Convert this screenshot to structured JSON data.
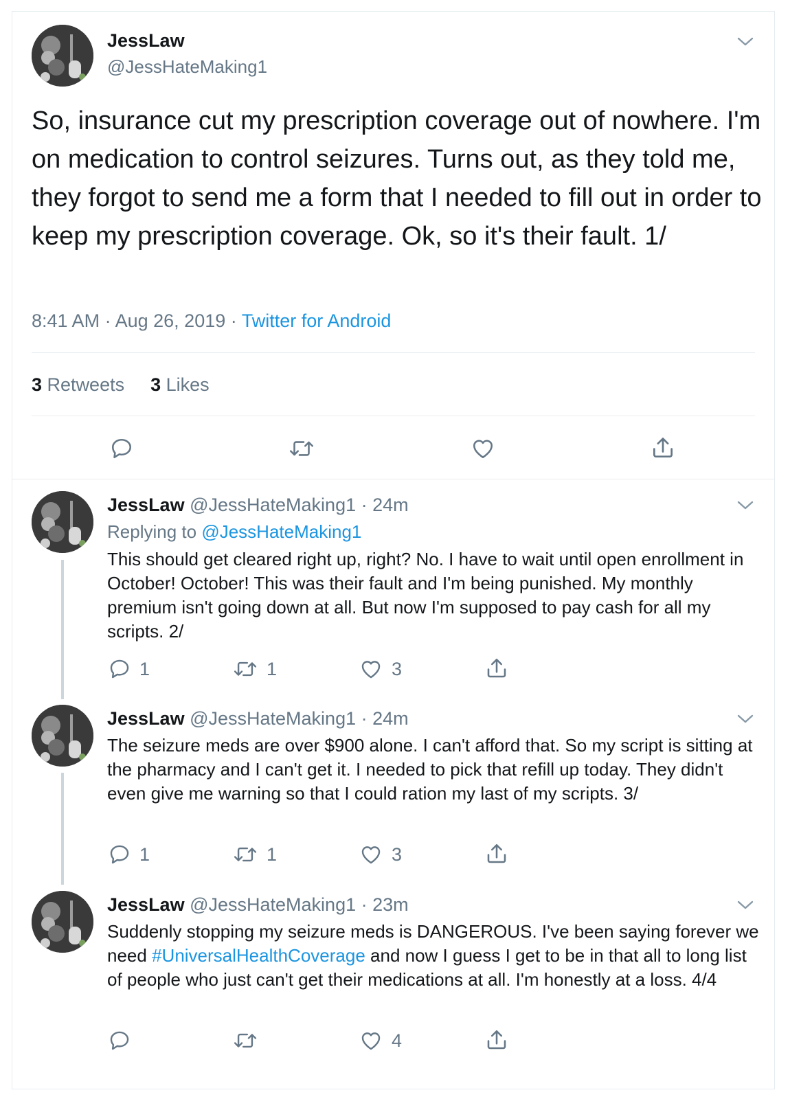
{
  "main_tweet": {
    "display_name": "JessLaw",
    "handle": "@JessHateMaking1",
    "text": "So, insurance cut my prescription coverage out of nowhere. I'm on medication to control seizures. Turns out, as they told me, they forgot to send me a form that I needed to fill out in order to keep my prescription coverage. Ok, so it's their fault. 1/",
    "time": "8:41 AM",
    "date": "Aug 26, 2019",
    "source": "Twitter for Android",
    "retweets_count": "3",
    "retweets_label": "Retweets",
    "likes_count": "3",
    "likes_label": "Likes",
    "icons": [
      "reply-icon",
      "retweet-icon",
      "like-icon",
      "share-icon"
    ]
  },
  "replies": [
    {
      "display_name": "JessLaw",
      "handle": "@JessHateMaking1",
      "age": "24m",
      "replying_prefix": "Replying to",
      "replying_to": "@JessHateMaking1",
      "text": "This should get cleared right up, right? No. I have to wait until open enrollment in October! October! This was their fault and I'm being punished. My monthly premium isn't going down at all. But now I'm supposed to pay cash for all my scripts. 2/",
      "reply_count": "1",
      "retweet_count": "1",
      "like_count": "3"
    },
    {
      "display_name": "JessLaw",
      "handle": "@JessHateMaking1",
      "age": "24m",
      "text": "The seizure meds are over $900 alone. I can't afford that. So my script is sitting at the pharmacy and I can't get it. I needed to pick that refill up today. They didn't even give me warning so that I could ration my last of my scripts. 3/",
      "reply_count": "1",
      "retweet_count": "1",
      "like_count": "3"
    },
    {
      "display_name": "JessLaw",
      "handle": "@JessHateMaking1",
      "age": "23m",
      "text_before": "Suddenly stopping my seizure meds is DANGEROUS. I've been saying forever we need ",
      "hashtag": "#UniversalHealthCoverage",
      "text_after": " and now I guess I get to be in that all to long list of people who just can't get their medications at all. I'm honestly at a loss. 4/4",
      "like_count": "4"
    }
  ],
  "separator": "·",
  "colors": {
    "text": "#14171a",
    "secondary": "#657786",
    "link": "#1b95e0",
    "border": "#e6ecf0",
    "thread_line": "#ccd6dd"
  }
}
